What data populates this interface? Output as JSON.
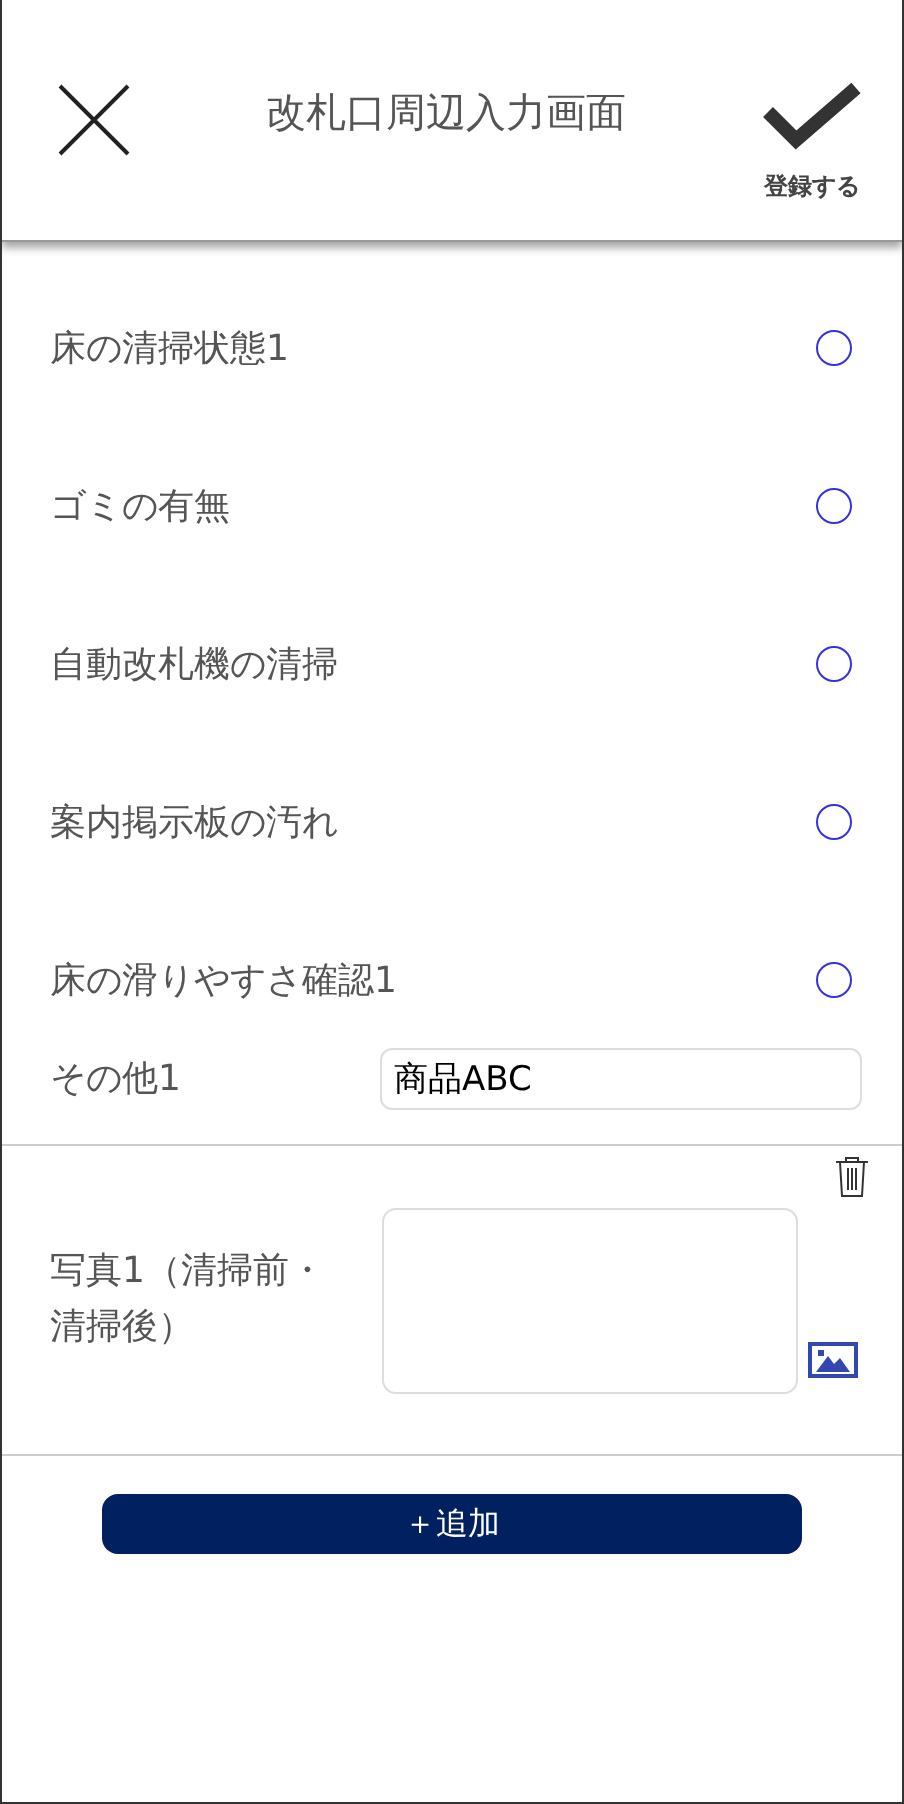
{
  "header": {
    "title": "改札口周辺入力画面",
    "submit_label": "登録する"
  },
  "checks": [
    {
      "label": "床の清掃状態1",
      "checked": false
    },
    {
      "label": "ゴミの有無",
      "checked": false
    },
    {
      "label": "自動改札機の清掃",
      "checked": false
    },
    {
      "label": "案内掲示板の汚れ",
      "checked": false
    },
    {
      "label": "床の滑りやすさ確認1",
      "checked": false
    }
  ],
  "other": {
    "label": "その他1",
    "value": "商品ABC"
  },
  "photo": {
    "label": "写真1（清掃前・清掃後）"
  },
  "add_button": "＋追加"
}
